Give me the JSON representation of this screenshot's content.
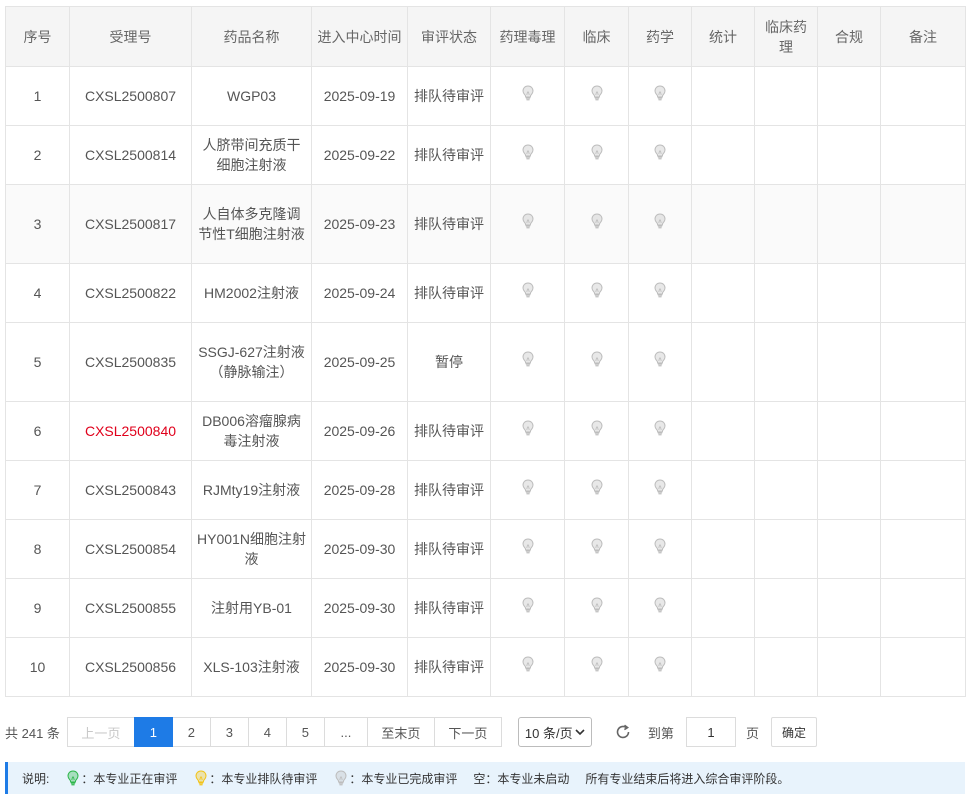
{
  "table": {
    "headers": [
      "序号",
      "受理号",
      "药品名称",
      "进入中心时间",
      "审评状态",
      "药理毒理",
      "临床",
      "药学",
      "统计",
      "临床药理",
      "合规",
      "备注"
    ],
    "rows": [
      {
        "no": "1",
        "accept_no": "CXSL2500807",
        "drug": "WGP03",
        "date": "2025-09-19",
        "status": "排队待审评",
        "highlight": false
      },
      {
        "no": "2",
        "accept_no": "CXSL2500814",
        "drug": "人脐带间充质干细胞注射液",
        "date": "2025-09-22",
        "status": "排队待审评",
        "highlight": false
      },
      {
        "no": "3",
        "accept_no": "CXSL2500817",
        "drug": "人自体多克隆调节性T细胞注射液",
        "date": "2025-09-23",
        "status": "排队待审评",
        "highlight": false
      },
      {
        "no": "4",
        "accept_no": "CXSL2500822",
        "drug": "HM2002注射液",
        "date": "2025-09-24",
        "status": "排队待审评",
        "highlight": false
      },
      {
        "no": "5",
        "accept_no": "CXSL2500835",
        "drug": "SSGJ-627注射液（静脉输注）",
        "date": "2025-09-25",
        "status": "暂停",
        "highlight": false
      },
      {
        "no": "6",
        "accept_no": "CXSL2500840",
        "drug": "DB006溶瘤腺病毒注射液",
        "date": "2025-09-26",
        "status": "排队待审评",
        "highlight": true
      },
      {
        "no": "7",
        "accept_no": "CXSL2500843",
        "drug": "RJMty19注射液",
        "date": "2025-09-28",
        "status": "排队待审评",
        "highlight": false
      },
      {
        "no": "8",
        "accept_no": "CXSL2500854",
        "drug": "HY001N细胞注射液",
        "date": "2025-09-30",
        "status": "排队待审评",
        "highlight": false
      },
      {
        "no": "9",
        "accept_no": "CXSL2500855",
        "drug": "注射用YB-01",
        "date": "2025-09-30",
        "status": "排队待审评",
        "highlight": false
      },
      {
        "no": "10",
        "accept_no": "CXSL2500856",
        "drug": "XLS-103注射液",
        "date": "2025-09-30",
        "status": "排队待审评",
        "highlight": false
      }
    ],
    "bulb_color": "#bdbdbd",
    "accent_red": "#e0001b"
  },
  "pagination": {
    "total": "共 241 条",
    "prev": "上一页",
    "pages": [
      "1",
      "2",
      "3",
      "4",
      "5"
    ],
    "ellipsis": "...",
    "last": "至末页",
    "next": "下一页",
    "page_size": "10 条/页",
    "goto_label": "到第",
    "current_page": "1",
    "page_unit": "页",
    "confirm": "确定",
    "active_color": "#1e7be6"
  },
  "legend": {
    "title": "说明:",
    "green_text": "：本专业正在审评",
    "yellow_text": "：本专业排队待审评",
    "gray_text": "：本专业已完成审评",
    "empty_text": "空：本专业未启动",
    "note": "所有专业结束后将进入综合审评阶段。",
    "green": "#2db64a",
    "yellow": "#f2c318",
    "gray": "#bdbdbd"
  }
}
